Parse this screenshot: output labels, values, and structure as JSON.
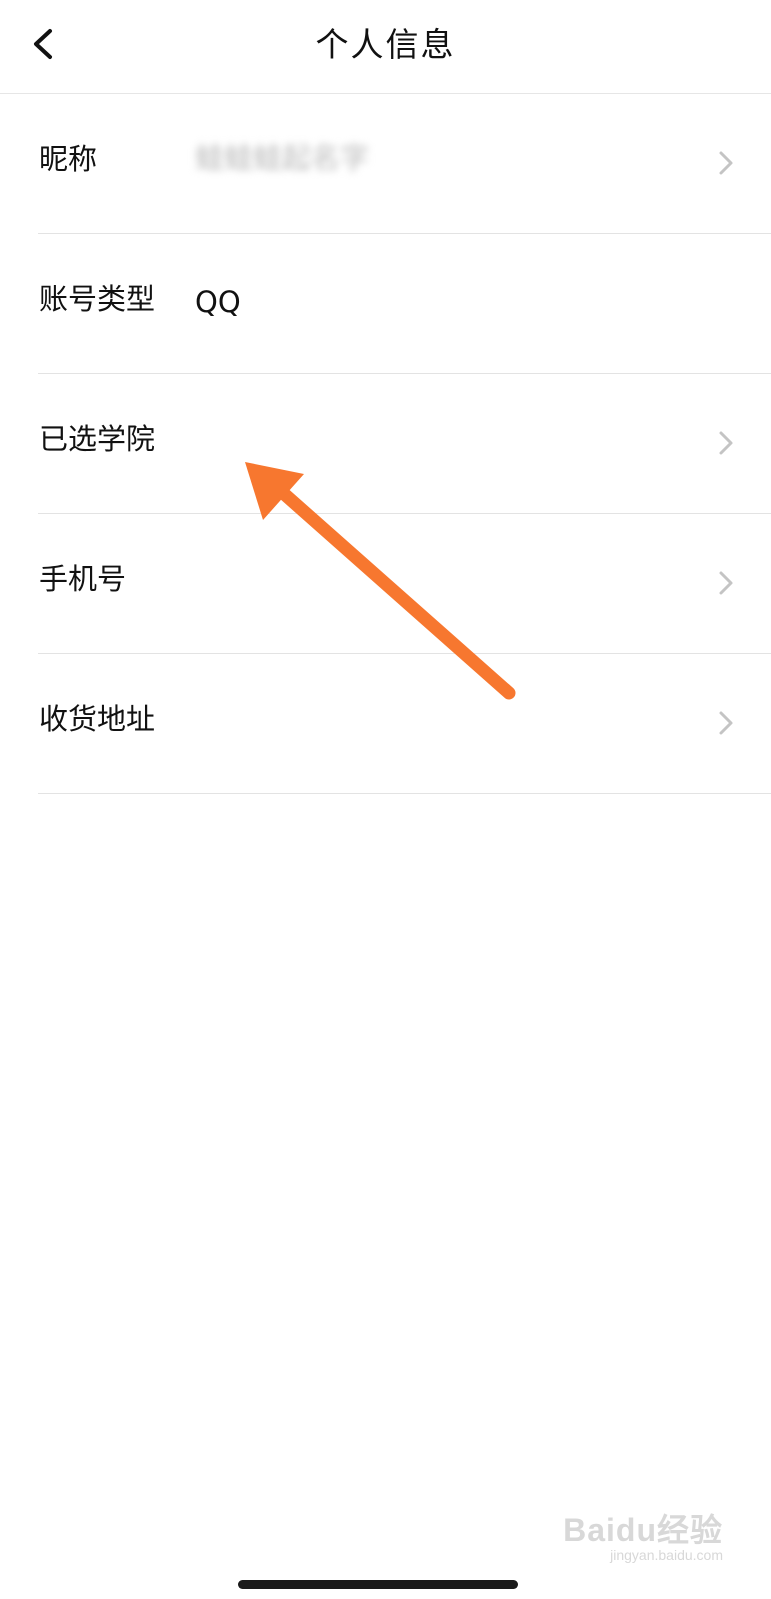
{
  "header": {
    "title": "个人信息",
    "back_icon": "chevron-left-icon"
  },
  "rows": [
    {
      "label": "昵称",
      "value": "蛙蛙蛙起名字",
      "value_blurred": true,
      "has_chevron": true
    },
    {
      "label": "账号类型",
      "value": "QQ",
      "value_blurred": false,
      "has_chevron": false
    },
    {
      "label": "已选学院",
      "value": "",
      "value_blurred": false,
      "has_chevron": true
    },
    {
      "label": "手机号",
      "value": "",
      "value_blurred": false,
      "has_chevron": true
    },
    {
      "label": "收货地址",
      "value": "",
      "value_blurred": false,
      "has_chevron": true
    }
  ],
  "annotation": {
    "type": "arrow",
    "color": "#f7772f",
    "points_to": "已选学院"
  },
  "watermark": {
    "brand": "Baidu经验",
    "url": "jingyan.baidu.com"
  },
  "colors": {
    "divider": "#e3e3e3",
    "chevron": "#c4c4c4",
    "text": "#111111"
  }
}
